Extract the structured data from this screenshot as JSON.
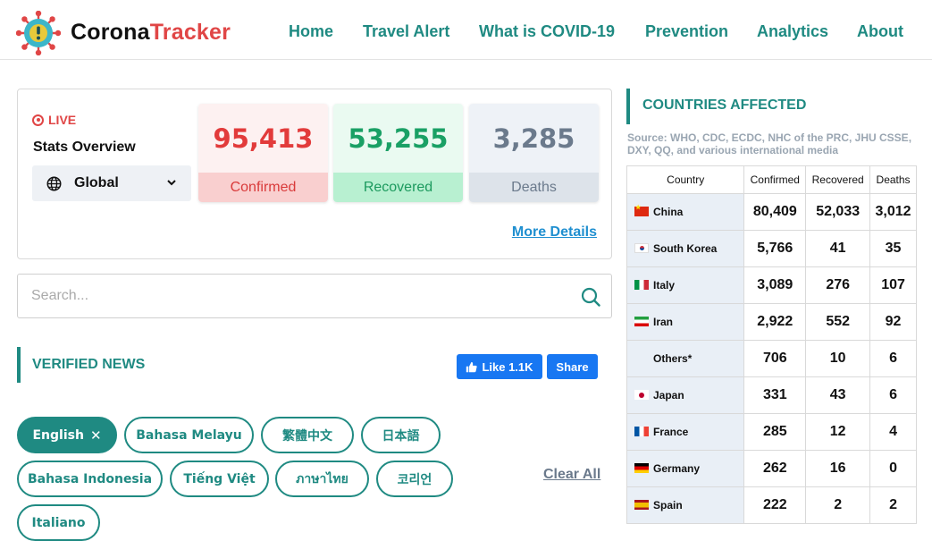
{
  "header": {
    "brand_a": "Corona",
    "brand_b": "Tracker",
    "nav": [
      "Home",
      "Travel Alert",
      "What is COVID-19",
      "Prevention",
      "Analytics",
      "About"
    ]
  },
  "stats": {
    "live_label": "LIVE",
    "title": "Stats Overview",
    "region": "Global",
    "confirmed": {
      "value": "95,413",
      "label": "Confirmed"
    },
    "recovered": {
      "value": "53,255",
      "label": "Recovered"
    },
    "deaths": {
      "value": "3,285",
      "label": "Deaths"
    },
    "more_details": "More Details"
  },
  "search": {
    "placeholder": "Search..."
  },
  "news": {
    "title": "VERIFIED NEWS",
    "like_label": "Like 1.1K",
    "share_label": "Share",
    "languages": [
      {
        "label": "English",
        "active": true
      },
      {
        "label": "Bahasa Melayu",
        "active": false
      },
      {
        "label": "繁體中文",
        "active": false
      },
      {
        "label": "日本語",
        "active": false
      },
      {
        "label": "Bahasa Indonesia",
        "active": false
      },
      {
        "label": "Tiếng Việt",
        "active": false
      },
      {
        "label": "ภาษาไทย",
        "active": false
      },
      {
        "label": "코리언",
        "active": false
      },
      {
        "label": "Italiano",
        "active": false
      }
    ],
    "clear_all": "Clear All"
  },
  "countries": {
    "title": "COUNTRIES AFFECTED",
    "source": "Source: WHO, CDC, ECDC, NHC of the PRC, JHU CSSE, DXY, QQ, and various international media",
    "columns": [
      "Country",
      "Confirmed",
      "Recovered",
      "Deaths"
    ],
    "rows": [
      {
        "flag": "cn",
        "name": "China",
        "confirmed": "80,409",
        "recovered": "52,033",
        "deaths": "3,012"
      },
      {
        "flag": "kr",
        "name": "South Korea",
        "confirmed": "5,766",
        "recovered": "41",
        "deaths": "35"
      },
      {
        "flag": "it",
        "name": "Italy",
        "confirmed": "3,089",
        "recovered": "276",
        "deaths": "107"
      },
      {
        "flag": "ir",
        "name": "Iran",
        "confirmed": "2,922",
        "recovered": "552",
        "deaths": "92"
      },
      {
        "flag": "",
        "name": "Others*",
        "confirmed": "706",
        "recovered": "10",
        "deaths": "6"
      },
      {
        "flag": "jp",
        "name": "Japan",
        "confirmed": "331",
        "recovered": "43",
        "deaths": "6"
      },
      {
        "flag": "fr",
        "name": "France",
        "confirmed": "285",
        "recovered": "12",
        "deaths": "4"
      },
      {
        "flag": "de",
        "name": "Germany",
        "confirmed": "262",
        "recovered": "16",
        "deaths": "0"
      },
      {
        "flag": "es",
        "name": "Spain",
        "confirmed": "222",
        "recovered": "2",
        "deaths": "2"
      }
    ]
  }
}
